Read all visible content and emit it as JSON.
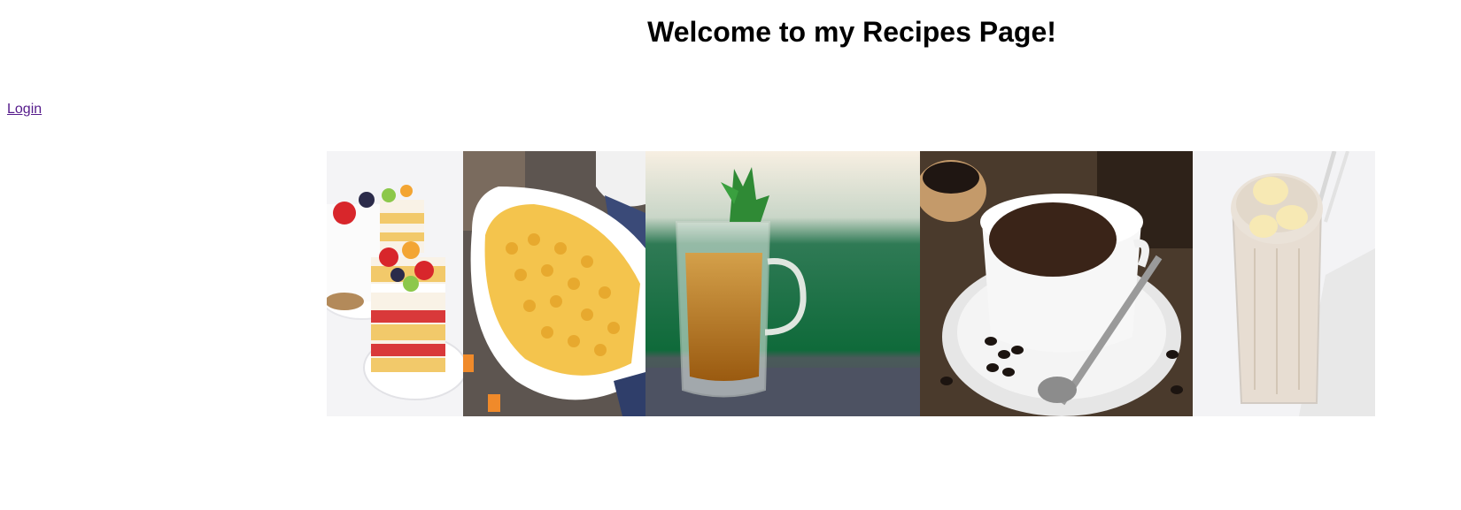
{
  "page": {
    "title": "Welcome to my Recipes Page!",
    "login_label": "Login"
  },
  "gallery": {
    "images": [
      {
        "name": "strawberry-cake-image"
      },
      {
        "name": "mac-and-cheese-image"
      },
      {
        "name": "iced-tea-image"
      },
      {
        "name": "coffee-cup-image"
      },
      {
        "name": "banana-smoothie-image"
      }
    ]
  }
}
